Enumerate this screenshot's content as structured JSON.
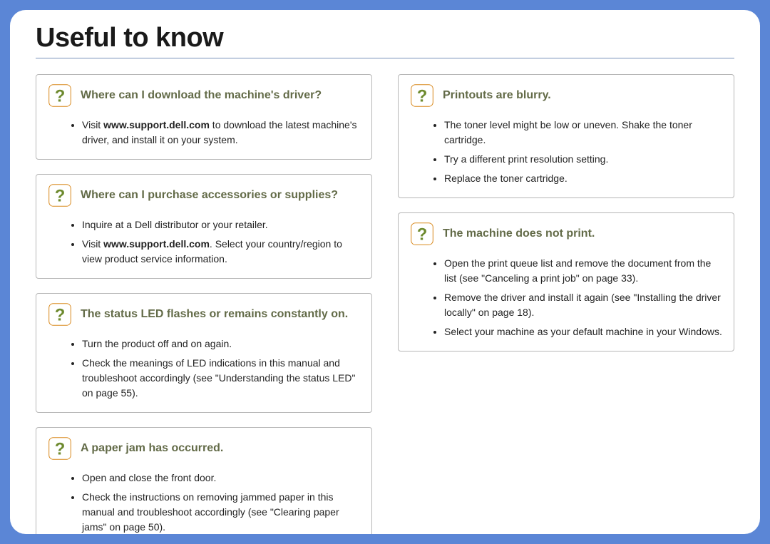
{
  "title": "Useful to know",
  "left": [
    {
      "heading": "Where can I download the machine's driver?",
      "items": [
        "Visit <b class=\"link\">www.support.dell.com</b> to download the latest machine's driver, and install it on your system."
      ]
    },
    {
      "heading": "Where can I purchase accessories or supplies?",
      "items": [
        "Inquire at a Dell distributor or your retailer.",
        "Visit <b class=\"link\">www.support.dell.com</b>. Select your country/region to view product service information."
      ]
    },
    {
      "heading": "The status LED flashes or remains constantly on.",
      "items": [
        "Turn the product off and on again.",
        "Check the meanings of LED indications in this manual and troubleshoot accordingly (see \"Understanding the status LED\" on page 55)."
      ]
    },
    {
      "heading": "A paper jam has occurred.",
      "items": [
        "Open and close the front door.",
        "Check the instructions on removing jammed paper in this manual and troubleshoot accordingly (see \"Clearing paper jams\" on page 50)."
      ]
    }
  ],
  "right": [
    {
      "heading": "Printouts are blurry.",
      "items": [
        "The toner level might be low or uneven. Shake the toner cartridge.",
        "Try a different print resolution setting.",
        "Replace the toner cartridge."
      ]
    },
    {
      "heading": "The machine does not print.",
      "items": [
        "Open the print queue list and remove the document from the list (see \"Canceling a print job\" on page 33).",
        "Remove the driver and install it again (see \"Installing the driver locally\" on page 18).",
        "Select your machine as your default machine in your Windows."
      ]
    }
  ]
}
